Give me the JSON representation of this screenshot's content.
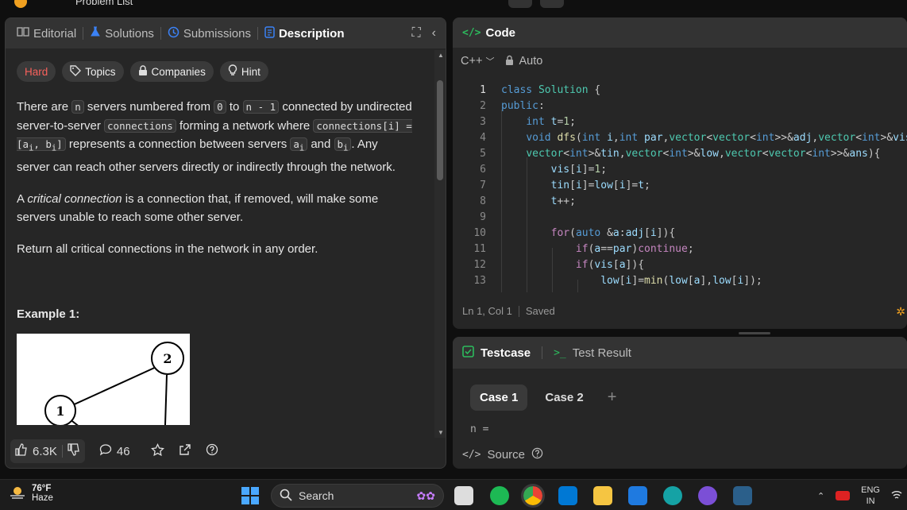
{
  "topbar": {
    "title": "Problem List"
  },
  "left_panel": {
    "tabs": [
      {
        "label": "Editorial"
      },
      {
        "label": "Solutions"
      },
      {
        "label": "Submissions"
      },
      {
        "label": "Description"
      }
    ],
    "chips": {
      "difficulty": "Hard",
      "topics": "Topics",
      "companies": "Companies",
      "hint": "Hint"
    },
    "description": {
      "p1_a": "There are ",
      "p1_n": "n",
      "p1_b": " servers numbered from ",
      "p1_zero": "0",
      "p1_c": " to ",
      "p1_nm1": "n - 1",
      "p1_d": " connected by undirected server-to-server ",
      "p1_conn": "connections",
      "p1_e": " forming a network where ",
      "p1_conni": "connections[i] = [a",
      "p1_sub_i1": "i",
      "p1_comma": ", b",
      "p1_sub_i2": "i",
      "p1_close": "]",
      "p1_f": " represents a connection between servers ",
      "p1_a_": "a",
      "p1_sub_i3": "i",
      "p1_and": " and ",
      "p1_b_": "b",
      "p1_sub_i4": "i",
      "p1_g": ". Any server can reach other servers directly or indirectly through the network.",
      "p2_a": "A ",
      "p2_em": "critical connection",
      "p2_b": " is a connection that, if removed, will make some servers unable to reach some other server.",
      "p3": "Return all critical connections in the network in any order.",
      "example_title": "Example 1:",
      "node_2": "2",
      "node_1": "1"
    },
    "bottom": {
      "likes": "6.3K",
      "comments": "46"
    }
  },
  "code_panel": {
    "title": "Code",
    "language": "C++",
    "mode": "Auto",
    "status_pos": "Ln 1, Col 1",
    "status_saved": "Saved"
  },
  "test_panel": {
    "tab_testcase": "Testcase",
    "tab_result": "Test Result",
    "case1": "Case 1",
    "case2": "Case 2",
    "n_label": "n =",
    "source": "Source"
  },
  "taskbar": {
    "temp": "76°F",
    "weather": "Haze",
    "search": "Search",
    "lang_line1": "ENG",
    "lang_line2": "IN"
  },
  "colors": {
    "hard": "#f8615c",
    "accent_green": "#2cbb5d",
    "description_blue": "#3b82f6"
  }
}
